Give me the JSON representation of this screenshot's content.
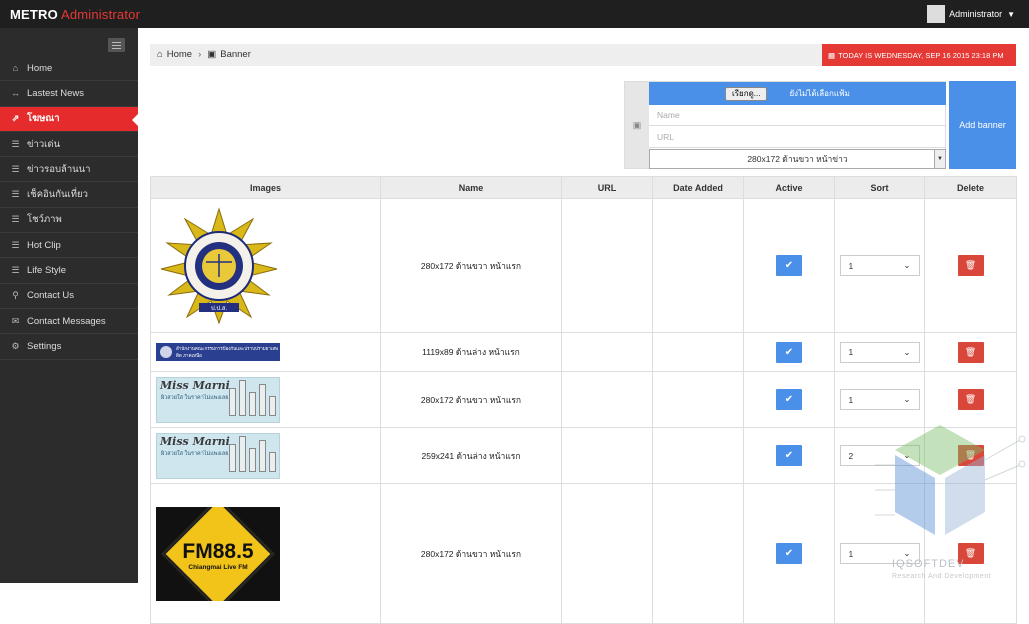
{
  "brand": {
    "name": "METRO",
    "accent": "Administrator"
  },
  "user": {
    "name": "Administrator"
  },
  "sidebar": {
    "items": [
      {
        "icon": "home-icon",
        "label": "Home"
      },
      {
        "icon": "arrows-h-icon",
        "label": "Lastest News"
      },
      {
        "icon": "external-link-icon",
        "label": "โฆษณา",
        "active": true
      },
      {
        "icon": "list-icon",
        "label": "ข่าวเด่น"
      },
      {
        "icon": "list-icon",
        "label": "ข่าวรอบล้านนา"
      },
      {
        "icon": "list-icon",
        "label": "เช็คอินกันเที่ยว"
      },
      {
        "icon": "list-icon",
        "label": "โชว์ภาพ"
      },
      {
        "icon": "list-icon",
        "label": "Hot Clip"
      },
      {
        "icon": "list-icon",
        "label": "Life Style"
      },
      {
        "icon": "map-marker-icon",
        "label": "Contact Us"
      },
      {
        "icon": "envelope-icon",
        "label": "Contact Messages"
      },
      {
        "icon": "cogs-icon",
        "label": "Settings"
      }
    ]
  },
  "breadcrumb": {
    "home": "Home",
    "current": "Banner"
  },
  "date_label": "TODAY IS WEDNESDAY, SEP 16 2015 23:18 PM",
  "form": {
    "browse_label": "เรียกดู...",
    "no_file": "ยังไม่ได้เลือกแฟ้ม",
    "name_placeholder": "Name",
    "url_placeholder": "URL",
    "position_value": "280x172 ด้านขวา หน้าข่าว",
    "add_label": "Add banner"
  },
  "table": {
    "headers": [
      "Images",
      "Name",
      "URL",
      "Date Added",
      "Active",
      "Sort",
      "Delete"
    ],
    "rows": [
      {
        "image": "seal",
        "name": "280x172 ด้านขวา หน้าแรก",
        "url": "",
        "date": "",
        "active": true,
        "sort": "1"
      },
      {
        "image": "strip",
        "name": "1119x89 ด้านล่าง หน้าแรก",
        "url": "",
        "date": "",
        "active": true,
        "sort": "1"
      },
      {
        "image": "missmarni",
        "name": "280x172 ด้านขวา หน้าแรก",
        "url": "",
        "date": "",
        "active": true,
        "sort": "1"
      },
      {
        "image": "missmarni",
        "name": "259x241 ด้านล่าง หน้าแรก",
        "url": "",
        "date": "",
        "active": true,
        "sort": "2"
      },
      {
        "image": "fm",
        "name": "280x172 ด้านขวา หน้าแรก",
        "url": "",
        "date": "",
        "active": true,
        "sort": "1"
      }
    ]
  },
  "banner_text": {
    "seal_top": "สำนักงานคณะกรรมการป้องกันและปราบปรามยาเสพติด",
    "seal_bottom": "ป.ป.ส.",
    "strip_text": "สำนักงานคณะกรรมการป้องกันและปราบปรามยาเสพติด ภาคเหนือ",
    "mm_title": "Miss Marni",
    "mm_tag": "ผิวสวยใส ในราคาไม่แพงเลย",
    "fm_title": "FM88.5",
    "fm_sub": "Chiangmai Live FM"
  },
  "watermark": {
    "title": "IQSOFTDEV",
    "subtitle": "Research And Development"
  },
  "colors": {
    "accent_red": "#e53935",
    "primary_blue": "#4a8fe8",
    "sidebar_bg": "#2c2c2c",
    "topbar_bg": "#1f1f1f"
  }
}
